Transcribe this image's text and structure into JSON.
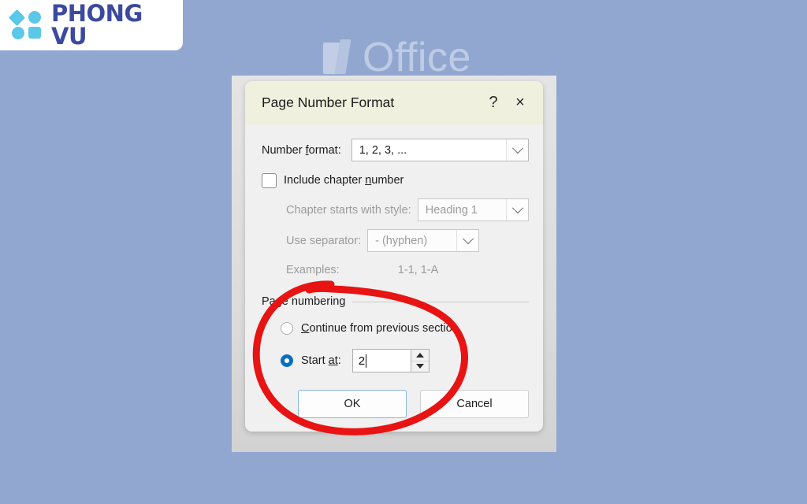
{
  "background": {
    "color": "#92a7d0"
  },
  "brand": {
    "name": "PHONG VU",
    "mark_color": "#5cc8e8",
    "text_color": "#3b4a9e",
    "shapes": [
      "diamond-shape",
      "circle-shape",
      "circle-shape",
      "rounded-square-shape"
    ]
  },
  "watermark": {
    "text": "Office",
    "icon": "office-logo-icon",
    "color": "#e3eaf6"
  },
  "dialog": {
    "title": "Page Number Format",
    "titlebar_color": "#eff0dd",
    "help_icon": "?",
    "close_icon": "×",
    "number_format": {
      "label_prefix": "Number ",
      "label_accel": "f",
      "label_suffix": "ormat:",
      "value": "1, 2, 3, ...",
      "arrow_icon": "chevron-down-icon"
    },
    "include_chapter": {
      "label_prefix": "Include chapter ",
      "label_accel": "n",
      "label_suffix": "umber",
      "checked": false
    },
    "chapter_style": {
      "label": "Chapter starts with style:",
      "value": "Heading 1",
      "enabled": false,
      "arrow_icon": "chevron-down-icon"
    },
    "separator": {
      "label": "Use separator:",
      "value": "-    (hyphen)",
      "enabled": false,
      "arrow_icon": "chevron-down-icon"
    },
    "examples": {
      "label": "Examples:",
      "value": "1-1, 1-A",
      "enabled": false
    },
    "page_numbering": {
      "group_label": "Page numbering",
      "continue_option": {
        "label_prefix": "",
        "label_accel": "C",
        "label_suffix": "ontinue from previous section",
        "selected": false
      },
      "start_at_option": {
        "label_prefix": "Start ",
        "label_accel": "at",
        "label_suffix": ":",
        "selected": true,
        "value": "2",
        "spinner_up_icon": "triangle-up-icon",
        "spinner_down_icon": "triangle-down-icon"
      }
    },
    "buttons": {
      "ok": "OK",
      "cancel": "Cancel",
      "ok_focused": true,
      "focus_color": "#86b9e0"
    }
  },
  "annotation": {
    "type": "hand-drawn-circle",
    "color": "#e81313",
    "stroke_width": 9
  }
}
